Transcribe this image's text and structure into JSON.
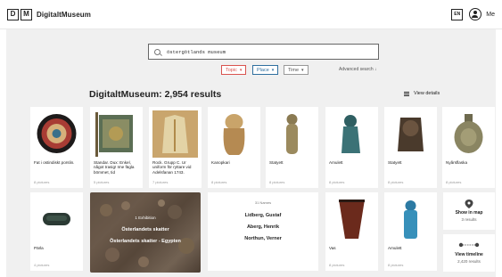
{
  "header": {
    "logo_letters": [
      "D",
      "M"
    ],
    "site_name": "DigitaltMuseum",
    "lang": "EN",
    "user_label": "Me"
  },
  "search": {
    "value": "östergötlands museum"
  },
  "filters": [
    {
      "label": "Topic",
      "color": "#d9534f"
    },
    {
      "label": "Place",
      "color": "#2f6f9f"
    },
    {
      "label": "Time",
      "color": "#777777"
    }
  ],
  "advanced_search": "Advanced search",
  "results_title": "DigitaltMuseum: 2,954 results",
  "view_details": "View details",
  "cards_row1": [
    {
      "title": "Fat i ostindiskt porslin.",
      "pics": "8 pictures",
      "icon": "plate-image"
    },
    {
      "title": "Standar. Dux: Enkel, något trasig! Ime fägla bömmet, tid",
      "pics": "5 pictures",
      "icon": "banner-image"
    },
    {
      "title": "Rock. Grupp C. Ur uniform för ryttare vid Adelsfanan 1743.",
      "pics": "7 pictures",
      "icon": "coat-image"
    },
    {
      "title": "Kanopkari",
      "pics": "8 pictures",
      "icon": "canopic-jar-image"
    },
    {
      "title": "Statyett",
      "pics": "8 pictures",
      "icon": "statuette-image"
    },
    {
      "title": "Amulett",
      "pics": "8 pictures",
      "icon": "amulet-image"
    },
    {
      "title": "Statyett",
      "pics": "8 pictures",
      "icon": "statuette-head-image"
    },
    {
      "title": "Nyårsflaska",
      "pics": "8 pictures",
      "icon": "flask-image"
    }
  ],
  "cards_row2": [
    {
      "title": "Pärla",
      "pics": "4 pictures",
      "icon": "bead-image"
    },
    {
      "title": "Vas",
      "pics": "8 pictures",
      "icon": "vase-image"
    },
    {
      "title": "Amulett",
      "pics": "8 pictures",
      "icon": "amulet-blue-image"
    }
  ],
  "exhibition": {
    "label": "1 Exhibition",
    "title": "Österlandets skatter",
    "subtitle": "Österlandets skatter - Egypten"
  },
  "names_card": {
    "count": "31 Names",
    "names": [
      "Lidberg, Gustaf",
      "Aberg, Henrik",
      "Northun, Verner"
    ]
  },
  "map_card": {
    "label": "Show in map",
    "sub": "3 results"
  },
  "timeline_card": {
    "label": "View timeline",
    "sub": "2,420 results"
  }
}
